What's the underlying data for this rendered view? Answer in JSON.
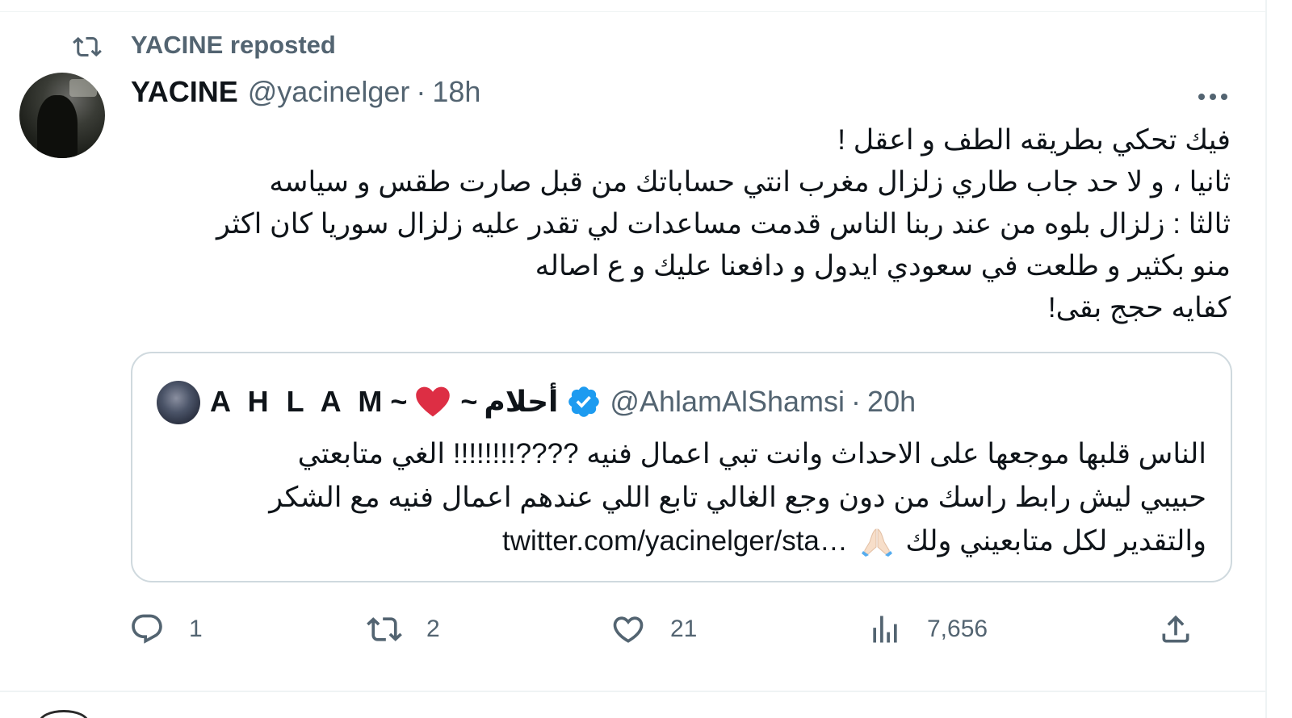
{
  "repost": {
    "label": "YACINE reposted",
    "icon": "retweet-icon"
  },
  "tweet": {
    "author_name": "YACINE",
    "author_handle": "@yacinelger",
    "separator": "·",
    "time": "18h",
    "more_icon": "more-icon",
    "lines": [
      "فيك تحكي بطريقه الطف و اعقل !",
      "ثانيا ، و لا حد جاب طاري زلزال مغرب انتي حساباتك من قبل صارت طقس و سياسه",
      "ثالثا : زلزال بلوه من عند ربنا الناس قدمت مساعدات لي تقدر عليه زلزال سوريا كان اكثر",
      "منو بكثير و طلعت في سعودي ايدول و دافعنا عليك و ع اصاله",
      "كفايه حجج بقى!"
    ]
  },
  "quote": {
    "name_latin": "A H L A M",
    "tilde_1": "~",
    "heart_emoji": "❤",
    "tilde_2": "~",
    "name_arabic": "أحلام",
    "verified_icon": "verified-badge-icon",
    "handle": "@AhlamAlShamsi",
    "separator": "·",
    "time": "20h",
    "line_1": "الناس قلبها موجعها على الاحداث وانت تبي اعمال فنيه ????!!!!!!!! الغي متابعتي",
    "line_2": "حبيبي ليش رابط راسك من دون وجع الغالي تابع اللي عندهم اعمال فنيه مع الشكر",
    "line_3_text": "والتقدير لكل متابعيني ولك",
    "line_3_emoji": "folded-hands-emoji",
    "line_3_link": "twitter.com/yacinelger/sta…"
  },
  "actions": {
    "reply_count": "1",
    "retweet_count": "2",
    "like_count": "21",
    "views_count": "7,656"
  },
  "colors": {
    "text": "#0f1419",
    "secondary": "#536471",
    "border": "#cfd9de",
    "verified": "#1d9bf0",
    "heart": "#dd2e44"
  }
}
